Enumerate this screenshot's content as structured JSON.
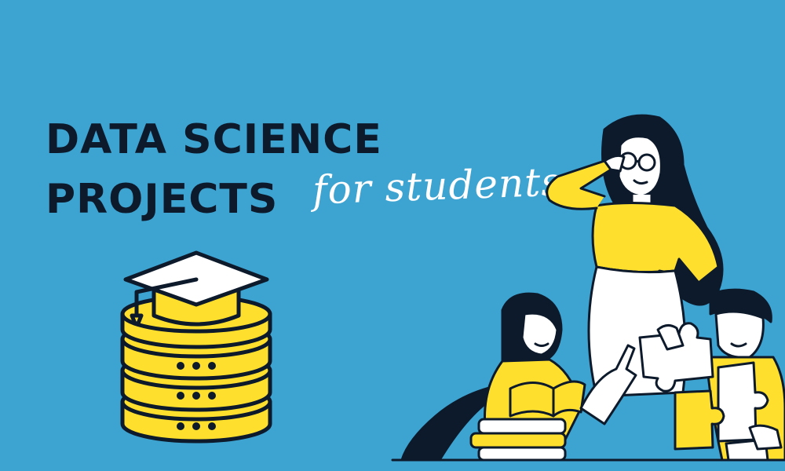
{
  "heading": {
    "line1": "DATA SCIENCE",
    "line2": "PROJECTS",
    "script": "for students"
  },
  "colors": {
    "background": "#3da3d1",
    "accent": "#ffdf2e",
    "ink": "#0d1a2b",
    "paper": "#ffffff"
  },
  "icons": {
    "database": "graduation-cap-database-icon",
    "illustration": "teacher-and-students-puzzle-illustration"
  }
}
